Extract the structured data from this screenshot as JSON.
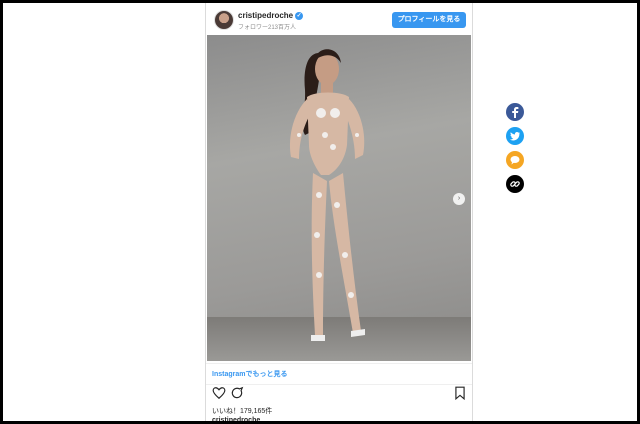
{
  "post": {
    "username": "cristipedroche",
    "followers": "フォロワー213百万人",
    "profile_button": "プロフィールを見る",
    "instagram_link": "Instagramでもっと見る",
    "likes": "いいね！179,165件",
    "caption_username": "cristipedroche"
  },
  "icons": {
    "verified": "verified-badge-icon",
    "next": "chevron-right-icon",
    "heart": "heart-icon",
    "comment": "comment-icon",
    "bookmark": "bookmark-icon"
  },
  "share_buttons": [
    {
      "name": "facebook",
      "color": "#3b5998",
      "icon": "facebook-icon"
    },
    {
      "name": "twitter",
      "color": "#1da1f2",
      "icon": "twitter-icon"
    },
    {
      "name": "comment",
      "color": "#f5a623",
      "icon": "speech-bubble-icon"
    },
    {
      "name": "link",
      "color": "#000000",
      "icon": "link-icon"
    }
  ]
}
